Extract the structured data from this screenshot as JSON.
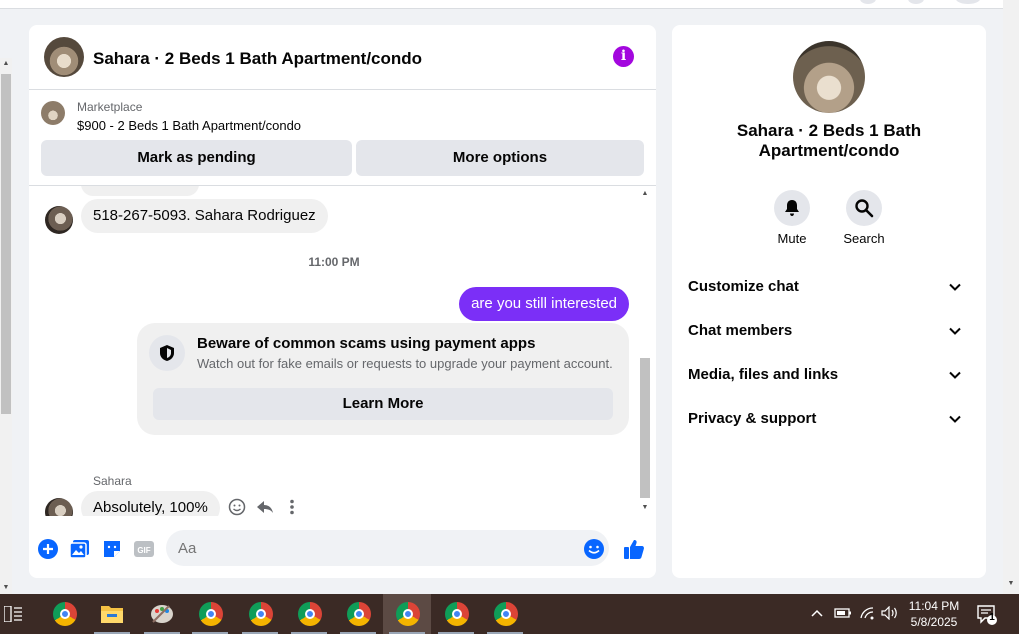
{
  "chat": {
    "title": "Sahara · 2 Beds 1 Bath Apartment/condo",
    "marketplace_label": "Marketplace",
    "listing": "$900 - 2 Beds 1 Bath Apartment/condo",
    "mark_pending": "Mark as pending",
    "more_options": "More options",
    "messages": {
      "phone_msg": "518-267-5093. Sahara Rodriguez",
      "time": "11:00 PM",
      "out_msg": "are you still interested",
      "scam_title": "Beware of common scams using payment apps",
      "scam_sub": "Watch out for fake emails or requests to upgrade your payment account.",
      "learn_more": "Learn More",
      "sender": "Sahara",
      "reply": "Absolutely, 100%"
    },
    "composer": {
      "placeholder": "Aa",
      "gif": "GIF"
    }
  },
  "info_panel": {
    "title": "Sahara · 2 Beds 1 Bath Apartment/condo",
    "mute": "Mute",
    "search": "Search",
    "sections": [
      "Customize chat",
      "Chat members",
      "Media, files and links",
      "Privacy & support"
    ]
  },
  "taskbar": {
    "time": "11:04 PM",
    "date": "5/8/2025",
    "notifications": "1"
  },
  "colors": {
    "accent": "#7b2ff7",
    "info": "#a307de",
    "messenger_blue": "#0866ff"
  }
}
